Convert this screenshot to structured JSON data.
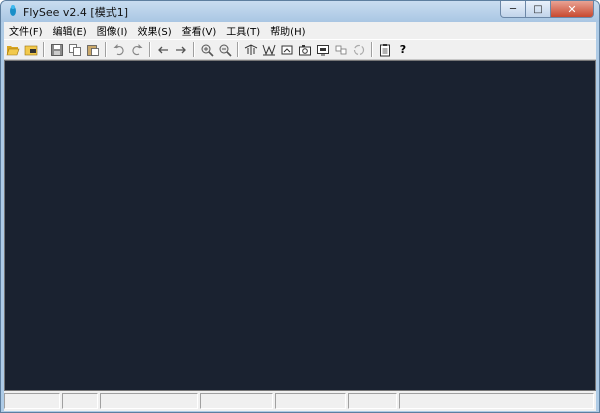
{
  "window": {
    "title": "FlySee v2.4 [模式1]",
    "caption": {
      "minimize": "─",
      "maximize": "□",
      "close": "✕"
    }
  },
  "menu": [
    {
      "label": "文件(F)"
    },
    {
      "label": "编辑(E)"
    },
    {
      "label": "图像(I)"
    },
    {
      "label": "效果(S)"
    },
    {
      "label": "查看(V)"
    },
    {
      "label": "工具(T)"
    },
    {
      "label": "帮助(H)"
    }
  ],
  "toolbar": {
    "help_label": "?"
  },
  "statusbar": {
    "panes": [
      "",
      "",
      "",
      "",
      "",
      "",
      ""
    ]
  },
  "colors": {
    "canvas_background": "#1a2230",
    "title_bar": "#aecbe6",
    "close_button": "#c8492f"
  }
}
